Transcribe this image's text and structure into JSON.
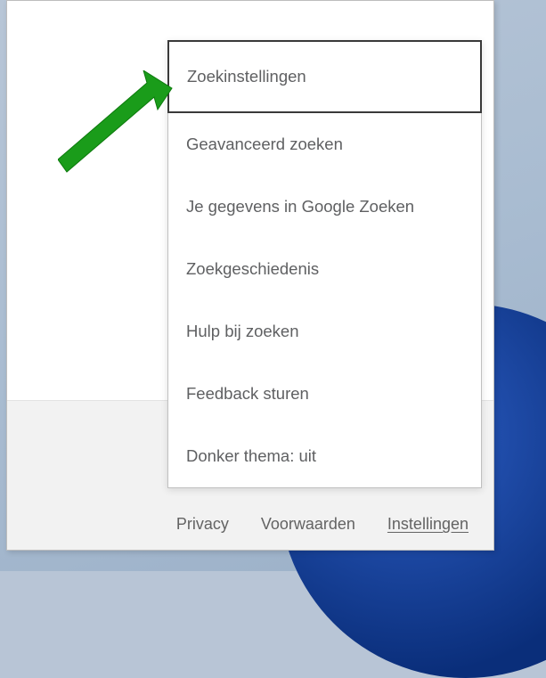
{
  "menu": {
    "items": [
      {
        "label": "Zoekinstellingen"
      },
      {
        "label": "Geavanceerd zoeken"
      },
      {
        "label": "Je gegevens in Google Zoeken"
      },
      {
        "label": "Zoekgeschiedenis"
      },
      {
        "label": "Hulp bij zoeken"
      },
      {
        "label": "Feedback sturen"
      },
      {
        "label": "Donker thema: uit"
      }
    ]
  },
  "footer": {
    "privacy": "Privacy",
    "terms": "Voorwaarden",
    "settings": "Instellingen"
  }
}
